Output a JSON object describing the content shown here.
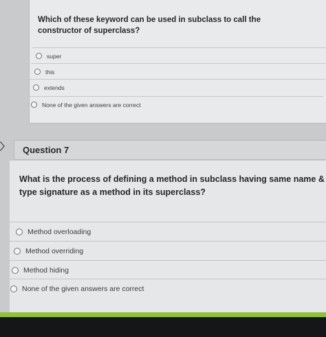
{
  "question6": {
    "text": "Which of these keyword can be used in subclass to call the constructor of superclass?",
    "options": [
      "super",
      "this",
      "extends",
      "None of the given answers are correct"
    ]
  },
  "question7": {
    "title": "Question 7",
    "text": "What is the process of defining a method in subclass having same name & type signature as a method in its superclass?",
    "options": [
      "Method overloading",
      "Method overriding",
      "Method hiding",
      "None of the given answers are correct"
    ]
  },
  "colors": {
    "accent_strip": "#8fc23a",
    "page_background": "#c9cacb"
  }
}
